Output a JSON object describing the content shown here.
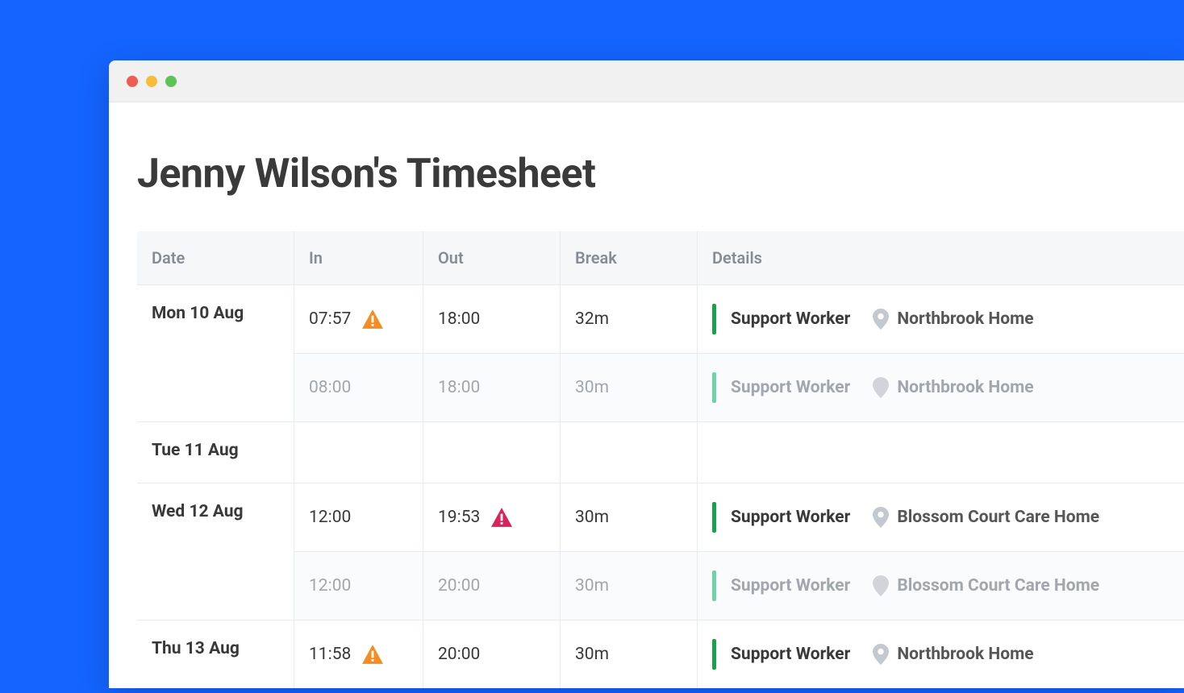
{
  "page_title": "Jenny Wilson's Timesheet",
  "table": {
    "headers": {
      "date": "Date",
      "in": "In",
      "out": "Out",
      "break": "Break",
      "details": "Details"
    },
    "days": [
      {
        "date": "Mon 10 Aug",
        "rows": [
          {
            "type": "actual",
            "in": "07:57",
            "in_warn": "orange",
            "out": "18:00",
            "out_warn": null,
            "break": "32m",
            "role": "Support Worker",
            "location": "Northbrook Home"
          },
          {
            "type": "scheduled",
            "in": "08:00",
            "in_warn": null,
            "out": "18:00",
            "out_warn": null,
            "break": "30m",
            "role": "Support Worker",
            "location": "Northbrook Home"
          }
        ]
      },
      {
        "date": "Tue 11 Aug",
        "rows": [
          {
            "type": "actual",
            "in": "",
            "in_warn": null,
            "out": "",
            "out_warn": null,
            "break": "",
            "role": "",
            "location": ""
          }
        ]
      },
      {
        "date": "Wed 12 Aug",
        "rows": [
          {
            "type": "actual",
            "in": "12:00",
            "in_warn": null,
            "out": "19:53",
            "out_warn": "red",
            "break": "30m",
            "role": "Support Worker",
            "location": "Blossom Court Care Home"
          },
          {
            "type": "scheduled",
            "in": "12:00",
            "in_warn": null,
            "out": "20:00",
            "out_warn": null,
            "break": "30m",
            "role": "Support Worker",
            "location": "Blossom Court Care Home"
          }
        ]
      },
      {
        "date": "Thu 13 Aug",
        "rows": [
          {
            "type": "actual",
            "in": "11:58",
            "in_warn": "orange",
            "out": "20:00",
            "out_warn": null,
            "break": "30m",
            "role": "Support Worker",
            "location": "Northbrook Home"
          }
        ]
      }
    ]
  },
  "colors": {
    "warn_orange": "#F58C1F",
    "warn_red": "#D9235A",
    "role_bar_dark": "#16A34A",
    "role_bar_light": "#6DD3A5"
  }
}
